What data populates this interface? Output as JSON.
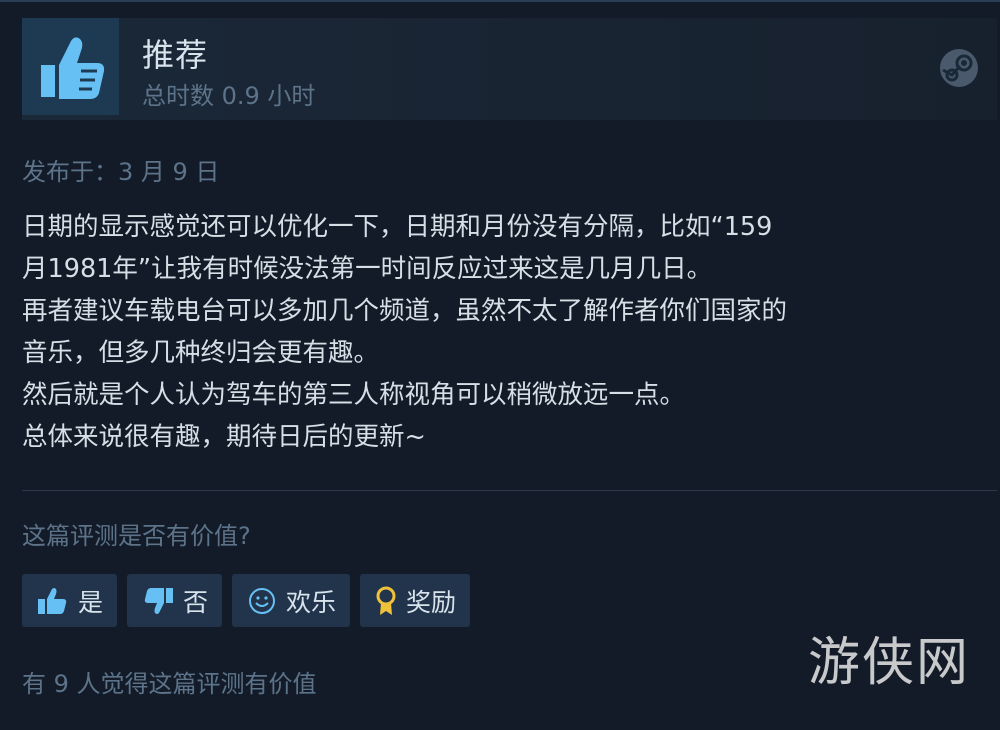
{
  "review": {
    "verdict": "推荐",
    "hours": "总时数 0.9 小时",
    "posted": "发布于：3 月 9 日",
    "body_lines": [
      "日期的显示感觉还可以优化一下，日期和月份没有分隔，比如“159",
      "月1981年”让我有时候没法第一时间反应过来这是几月几日。",
      "再者建议车载电台可以多加几个频道，虽然不太了解作者你们国家的",
      "音乐，但多几种终归会更有趣。",
      "然后就是个人认为驾车的第三人称视角可以稍微放远一点。",
      "总体来说很有趣，期待日后的更新~"
    ]
  },
  "feedback": {
    "question": "这篇评测是否有价值?",
    "buttons": {
      "yes": "是",
      "no": "否",
      "funny": "欢乐",
      "award": "奖励"
    },
    "helpful_count": "有 9 人觉得这篇评测有价值"
  },
  "watermark": "游侠网",
  "colors": {
    "background": "#131b28",
    "thumb_icon": "#66c0f4",
    "award_icon": "#f0c23a",
    "muted_text": "#5c7389"
  },
  "icons": [
    "thumbs-up-icon",
    "steam-logo-icon",
    "thumbs-down-icon",
    "smiley-icon",
    "award-ribbon-icon"
  ]
}
